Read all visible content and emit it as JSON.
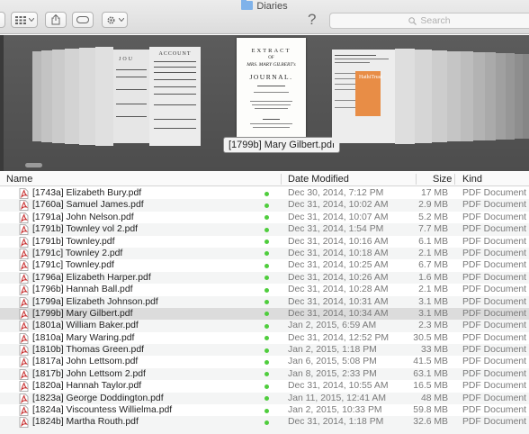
{
  "window": {
    "title": "Diaries"
  },
  "toolbar": {
    "view_icon": "grid-icon",
    "share_icon": "share-icon",
    "tags_icon": "tag-icon",
    "action_icon": "gear-icon",
    "help_label": "?",
    "search_placeholder": "Search"
  },
  "coverflow": {
    "selected_caption": "[1799b] Mary Gilbert.pdf",
    "selected_doc": {
      "line1": "EXTRACT",
      "line2": "OF",
      "line3": "MRS. MARY GILBERT's",
      "line4": "JOURNAL."
    },
    "left_doc_text": "ACCOUNT",
    "left_doc_text2": "JOU",
    "right_doc_text": "HathiTrust"
  },
  "columns": {
    "name": "Name",
    "date": "Date Modified",
    "size": "Size",
    "kind": "Kind"
  },
  "files": [
    {
      "name": "[1743a] Elizabeth Bury.pdf",
      "date": "Dec 30, 2014, 7:12 PM",
      "size": "17 MB",
      "kind": "PDF Document"
    },
    {
      "name": "[1760a] Samuel James.pdf",
      "date": "Dec 31, 2014, 10:02 AM",
      "size": "2.9 MB",
      "kind": "PDF Document"
    },
    {
      "name": "[1791a] John Nelson.pdf",
      "date": "Dec 31, 2014, 10:07 AM",
      "size": "5.2 MB",
      "kind": "PDF Document"
    },
    {
      "name": "[1791b] Townley vol 2.pdf",
      "date": "Dec 31, 2014, 1:54 PM",
      "size": "7.7 MB",
      "kind": "PDF Document"
    },
    {
      "name": "[1791b] Townley.pdf",
      "date": "Dec 31, 2014, 10:16 AM",
      "size": "6.1 MB",
      "kind": "PDF Document"
    },
    {
      "name": "[1791c] Townley 2.pdf",
      "date": "Dec 31, 2014, 10:18 AM",
      "size": "2.1 MB",
      "kind": "PDF Document"
    },
    {
      "name": "[1791c] Townley.pdf",
      "date": "Dec 31, 2014, 10:25 AM",
      "size": "6.7 MB",
      "kind": "PDF Document"
    },
    {
      "name": "[1796a] Elizabeth Harper.pdf",
      "date": "Dec 31, 2014, 10:26 AM",
      "size": "1.6 MB",
      "kind": "PDF Document"
    },
    {
      "name": "[1796b] Hannah Ball.pdf",
      "date": "Dec 31, 2014, 10:28 AM",
      "size": "2.1 MB",
      "kind": "PDF Document"
    },
    {
      "name": "[1799a] Elizabeth Johnson.pdf",
      "date": "Dec 31, 2014, 10:31 AM",
      "size": "3.1 MB",
      "kind": "PDF Document"
    },
    {
      "name": "[1799b] Mary Gilbert.pdf",
      "date": "Dec 31, 2014, 10:34 AM",
      "size": "3.1 MB",
      "kind": "PDF Document",
      "selected": true
    },
    {
      "name": "[1801a] William Baker.pdf",
      "date": "Jan 2, 2015, 6:59 AM",
      "size": "2.3 MB",
      "kind": "PDF Document"
    },
    {
      "name": "[1810a] Mary Waring.pdf",
      "date": "Dec 31, 2014, 12:52 PM",
      "size": "30.5 MB",
      "kind": "PDF Document"
    },
    {
      "name": "[1810b] Thomas Green.pdf",
      "date": "Jan 2, 2015, 1:18 PM",
      "size": "33 MB",
      "kind": "PDF Document"
    },
    {
      "name": "[1817a] John Lettsom.pdf",
      "date": "Jan 6, 2015, 5:08 PM",
      "size": "41.5 MB",
      "kind": "PDF Document"
    },
    {
      "name": "[1817b] John Lettsom 2.pdf",
      "date": "Jan 8, 2015, 2:33 PM",
      "size": "63.1 MB",
      "kind": "PDF Document"
    },
    {
      "name": "[1820a] Hannah Taylor.pdf",
      "date": "Dec 31, 2014, 10:55 AM",
      "size": "16.5 MB",
      "kind": "PDF Document"
    },
    {
      "name": "[1823a] George Doddington.pdf",
      "date": "Jan 11, 2015, 12:41 AM",
      "size": "48 MB",
      "kind": "PDF Document"
    },
    {
      "name": "[1824a] Viscountess Willielma.pdf",
      "date": "Jan 2, 2015, 10:33 PM",
      "size": "59.8 MB",
      "kind": "PDF Document"
    },
    {
      "name": "[1824b] Martha Routh.pdf",
      "date": "Dec 31, 2014, 1:18 PM",
      "size": "32.6 MB",
      "kind": "PDF Document"
    }
  ],
  "colors": {
    "tag_green": "#4fcd3d",
    "selection": "#dcdcdc",
    "pdf_red": "#c62a2a"
  }
}
